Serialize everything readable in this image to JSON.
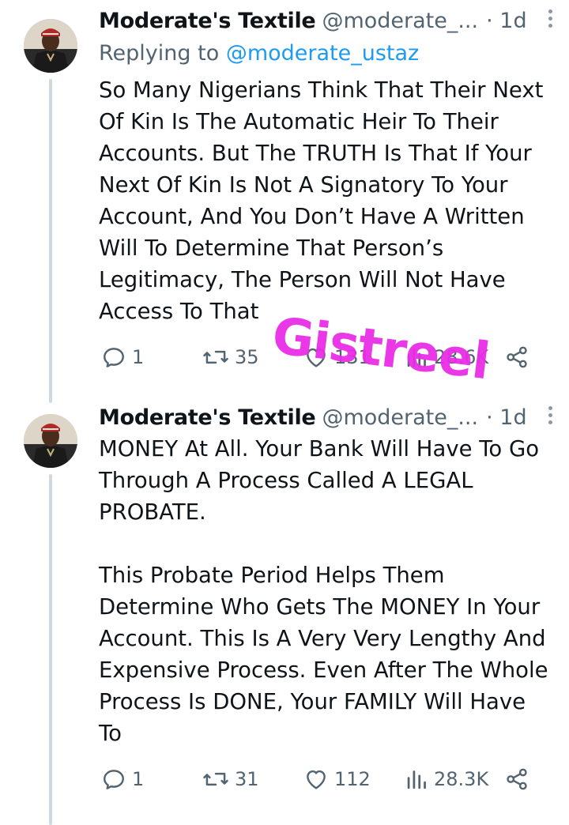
{
  "tweets": [
    {
      "author_name": "Moderate's Textile",
      "handle": "@moderate_...",
      "time": "· 1d",
      "replying_prefix": "Replying to ",
      "replying_to": "@moderate_ustaz",
      "text": "So Many Nigerians Think That Their Next\nOf Kin Is The Automatic Heir To Their\nAccounts. But The TRUTH Is That If Your\nNext Of Kin Is Not A Signatory To Your\nAccount, And You Don’t Have A Written\nWill To Determine That Person’s\nLegitimacy, The Person Will Not Have\nAccess To That",
      "replies": "1",
      "reposts": "35",
      "likes": "131",
      "views": "28.6K"
    },
    {
      "author_name": "Moderate's Textile",
      "handle": "@moderate_...",
      "time": "· 1d",
      "text": "MONEY At All. Your Bank Will Have To Go\nThrough A Process Called A LEGAL\nPROBATE.\n\nThis Probate Period Helps Them\nDetermine Who Gets The MONEY In Your\nAccount. This Is A Very Very Lengthy And\nExpensive Process. Even After The Whole\nProcess Is DONE, Your FAMILY Will Have\nTo",
      "replies": "1",
      "reposts": "31",
      "likes": "112",
      "views": "28.3K"
    }
  ],
  "watermark": "Gistreel",
  "colors": {
    "accent": "#1d9bf0",
    "muted": "#536471",
    "watermark": "#e92de6"
  },
  "icons": [
    "more-icon",
    "reply-icon",
    "repost-icon",
    "like-icon",
    "views-icon",
    "share-icon"
  ]
}
